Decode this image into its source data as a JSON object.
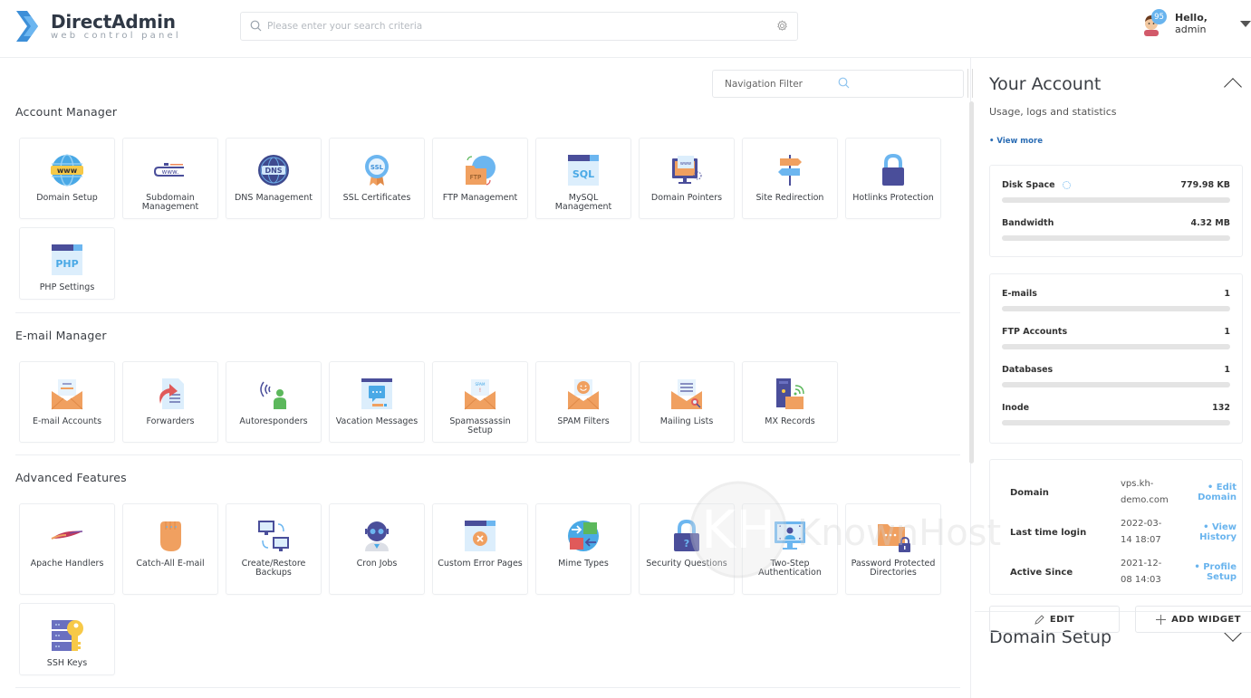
{
  "header": {
    "logo_title": "DirectAdmin",
    "logo_subtitle": "web control panel",
    "search_placeholder": "Please enter your search criteria",
    "notification_count": "95",
    "greeting": "Hello,",
    "username": "admin"
  },
  "main": {
    "nav_filter_placeholder": "Navigation Filter",
    "sections": [
      {
        "title": "Account Manager",
        "items": [
          {
            "label": "Domain Setup",
            "icon": "globe-www-icon"
          },
          {
            "label": "Subdomain Management",
            "icon": "subdomain-icon"
          },
          {
            "label": "DNS Management",
            "icon": "dns-globe-icon"
          },
          {
            "label": "SSL Certificates",
            "icon": "ssl-badge-icon"
          },
          {
            "label": "FTP Management",
            "icon": "ftp-folder-icon"
          },
          {
            "label": "MySQL Management",
            "icon": "sql-window-icon"
          },
          {
            "label": "Domain Pointers",
            "icon": "monitor-pointer-icon"
          },
          {
            "label": "Site Redirection",
            "icon": "signpost-icon"
          },
          {
            "label": "Hotlinks Protection",
            "icon": "padlock-icon"
          },
          {
            "label": "PHP Settings",
            "icon": "php-window-icon"
          }
        ]
      },
      {
        "title": "E-mail Manager",
        "items": [
          {
            "label": "E-mail Accounts",
            "icon": "envelope-open-icon"
          },
          {
            "label": "Forwarders",
            "icon": "forward-document-icon"
          },
          {
            "label": "Autoresponders",
            "icon": "person-broadcast-icon"
          },
          {
            "label": "Vacation Messages",
            "icon": "chat-window-icon"
          },
          {
            "label": "Spamassassin Setup",
            "icon": "spam-envelope-icon"
          },
          {
            "label": "SPAM Filters",
            "icon": "smiley-envelope-icon"
          },
          {
            "label": "Mailing Lists",
            "icon": "list-envelope-icon"
          },
          {
            "label": "MX Records",
            "icon": "server-mail-icon"
          }
        ]
      },
      {
        "title": "Advanced Features",
        "items": [
          {
            "label": "Apache Handlers",
            "icon": "apache-feather-icon"
          },
          {
            "label": "Catch-All E-mail",
            "icon": "hand-icon"
          },
          {
            "label": "Create/Restore Backups",
            "icon": "backup-monitors-icon"
          },
          {
            "label": "Cron Jobs",
            "icon": "robot-icon"
          },
          {
            "label": "Custom Error Pages",
            "icon": "error-window-icon"
          },
          {
            "label": "Mime Types",
            "icon": "mime-globe-icon"
          },
          {
            "label": "Security Questions",
            "icon": "question-lock-icon"
          },
          {
            "label": "Two-Step Authentication",
            "icon": "face-scan-monitor-icon"
          },
          {
            "label": "Password Protected Directories",
            "icon": "locked-folder-icon"
          },
          {
            "label": "SSH Keys",
            "icon": "server-key-icon"
          }
        ]
      }
    ]
  },
  "sidebar": {
    "account": {
      "title": "Your Account",
      "subtitle": "Usage, logs and statistics",
      "view_more": "• View more"
    },
    "usage": [
      {
        "label": "Disk Space",
        "value": "779.98 KB",
        "fraction": 0.0
      },
      {
        "label": "Bandwidth",
        "value": "4.32 MB",
        "fraction": 0.0
      }
    ],
    "counts": [
      {
        "label": "E-mails",
        "value": "1",
        "fraction": 0.0
      },
      {
        "label": "FTP Accounts",
        "value": "1",
        "fraction": 0.0
      },
      {
        "label": "Databases",
        "value": "1",
        "fraction": 0.0
      },
      {
        "label": "Inode",
        "value": "132",
        "fraction": 0.0
      }
    ],
    "info": [
      {
        "label": "Domain",
        "value": "vps.kh-demo.com",
        "link": "• Edit Domain"
      },
      {
        "label": "Last time login",
        "value": "2022-03-14 18:07",
        "link": "• View History"
      },
      {
        "label": "Active Since",
        "value": "2021-12-08 14:03",
        "link": "• Profile Setup"
      }
    ],
    "domain_setup": {
      "title": "Domain Setup",
      "edit_label": "EDIT",
      "add_widget_label": "ADD WIDGET"
    }
  },
  "watermark": {
    "text": "KnownHost"
  },
  "colors": {
    "accent": "#69b4ee",
    "link_dark": "#2a6cb4",
    "logo_blue": "#4a9fe0",
    "bar_track": "#e4e4e4"
  }
}
